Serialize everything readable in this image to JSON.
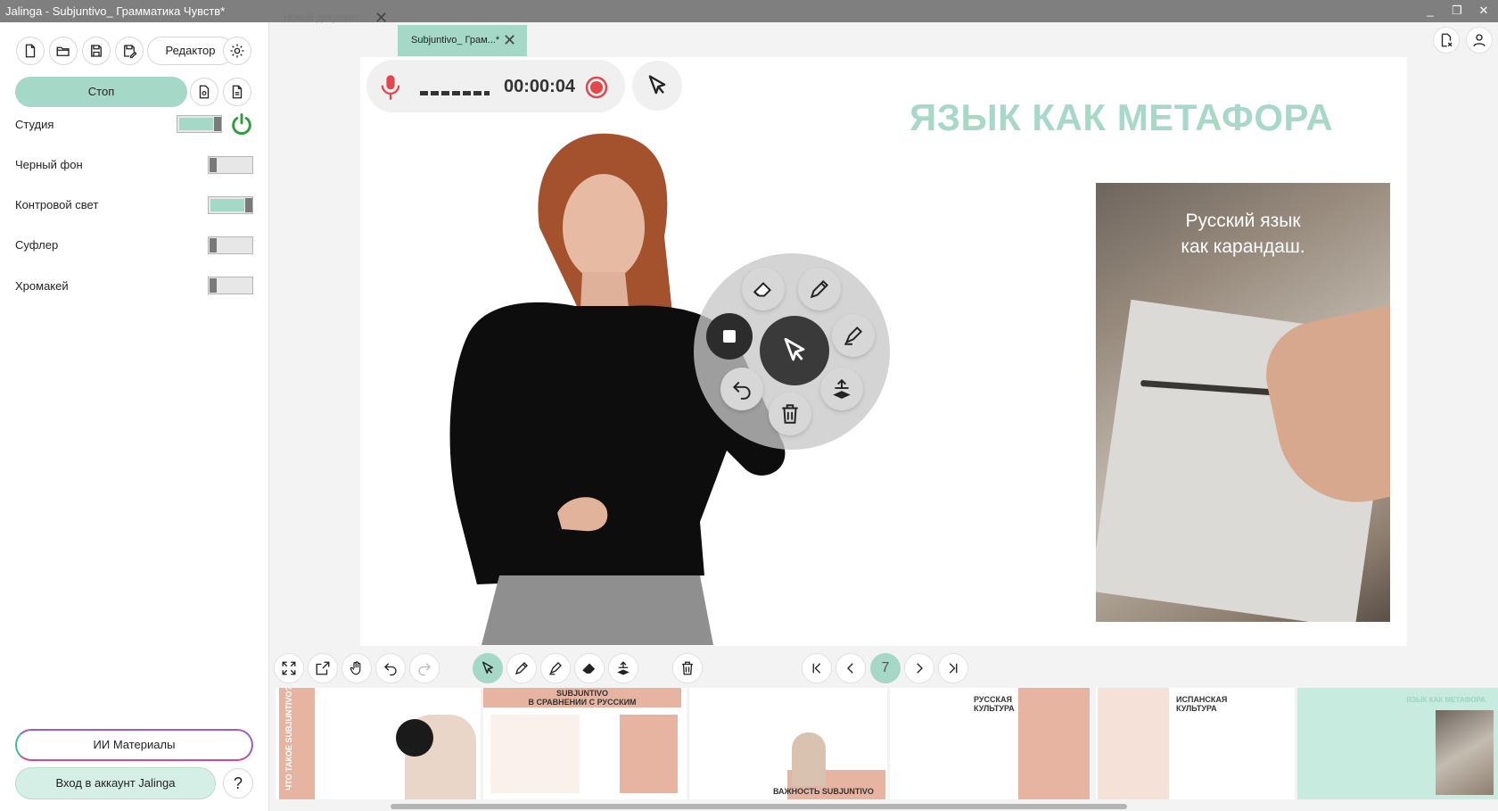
{
  "window": {
    "title": "Jalinga - Subjuntivo_ Грамматика Чувств*",
    "controls": [
      "_",
      "❐",
      "✕"
    ]
  },
  "left_panel": {
    "editor_label": "Редактор",
    "stop_label": "Стоп",
    "settings": [
      {
        "label": "Студия",
        "on": true
      },
      {
        "label": "Черный фон",
        "on": false
      },
      {
        "label": "Контровой свет",
        "on": true
      },
      {
        "label": "Суфлер",
        "on": false
      },
      {
        "label": "Хромакей",
        "on": false
      }
    ],
    "ai_materials_label": "ИИ Материалы",
    "login_label": "Вход в аккаунт Jalinga",
    "help_label": "?"
  },
  "tabs": [
    {
      "label": "Новый документ",
      "active": false
    },
    {
      "label": "Subjuntivo_ Грам...*",
      "active": true
    }
  ],
  "recorder": {
    "time": "00:00:04"
  },
  "slide": {
    "title": "ЯЗЫК КАК МЕТАФОРА",
    "photo_caption_line1": "Русский язык",
    "photo_caption_line2": "как карандаш."
  },
  "pagination": {
    "current_page": "7"
  },
  "thumbnails": {
    "t1_side": "ЧТО ТАКОЕ SUBJUNTIVO?",
    "t2_title_line1": "SUBJUNTIVO",
    "t2_title_line2": "В СРАВНЕНИИ С РУССКИМ",
    "t3_footer": "ВАЖНОСТЬ SUBJUNTIVO",
    "t4_title_line1": "РУССКАЯ",
    "t4_title_line2": "КУЛЬТУРА",
    "t5_title_line1": "ИСПАНСКАЯ",
    "t5_title_line2": "КУЛЬТУРА",
    "t6_title": "ЯЗЫК КАК МЕТАФОРА"
  },
  "colors": {
    "accent": "#a5d8c6",
    "title_bar": "#7f7f7f",
    "record_red": "#e0484d"
  },
  "icons": {
    "power": "power-icon",
    "mic": "microphone-icon",
    "record": "record-icon"
  }
}
